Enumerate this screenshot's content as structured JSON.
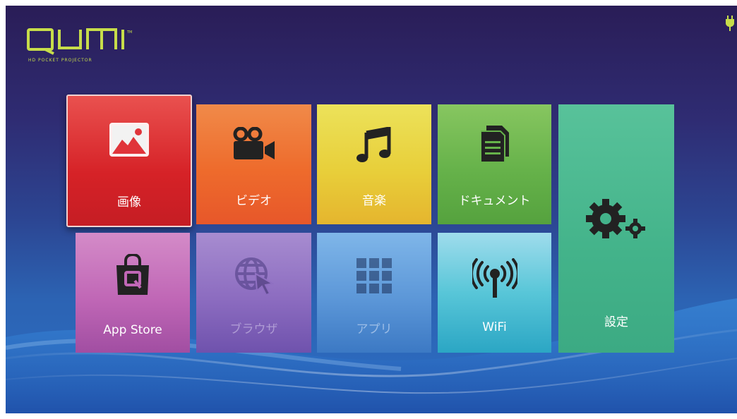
{
  "logo": {
    "brand": "QUMI",
    "tagline": "HD POCKET PROJECTOR"
  },
  "status": {
    "icon": "plug-icon",
    "color": "#c7dd4a"
  },
  "tiles": {
    "image": {
      "label": "画像",
      "icon": "image-icon",
      "color": "#d62227"
    },
    "video": {
      "label": "ビデオ",
      "icon": "video-camera-icon",
      "color": "#ee6b2c"
    },
    "music": {
      "label": "音楽",
      "icon": "music-note-icon",
      "color": "#e8cf3a"
    },
    "documents": {
      "label": "ドキュメント",
      "icon": "document-icon",
      "color": "#66b24a"
    },
    "settings": {
      "label": "設定",
      "icon": "gears-icon",
      "color": "#43b38a"
    },
    "app_store": {
      "label": "App Store",
      "icon": "shopping-bag-icon",
      "color": "#c067b6"
    },
    "browser": {
      "label": "ブラウザ",
      "icon": "globe-cursor-icon",
      "color": "#8c6cc0"
    },
    "apps": {
      "label": "アプリ",
      "icon": "grid-icon",
      "color": "#5c97d8"
    },
    "wifi": {
      "label": "WiFi",
      "icon": "wifi-antenna-icon",
      "color": "#58c6d8"
    }
  }
}
